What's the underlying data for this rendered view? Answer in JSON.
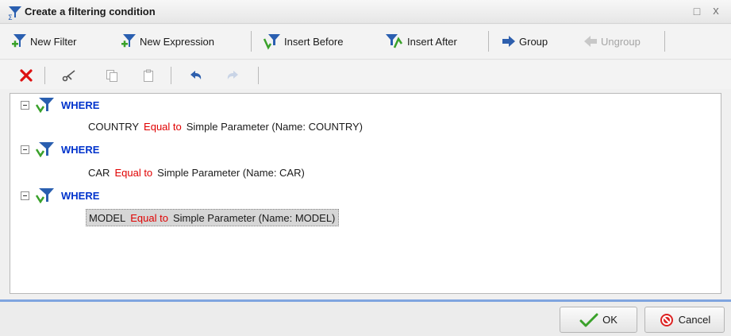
{
  "window": {
    "title": "Create a filtering condition",
    "maximize_glyph": "□",
    "close_glyph": "x"
  },
  "toolbar1": {
    "new_filter": "New Filter",
    "new_expression": "New Expression",
    "insert_before": "Insert Before",
    "insert_after": "Insert After",
    "group": "Group",
    "ungroup": "Ungroup"
  },
  "toolbar2": {
    "icons": [
      "delete-icon",
      "cut-icon",
      "copy-icon",
      "paste-icon",
      "undo-icon",
      "redo-icon"
    ]
  },
  "tree": {
    "groups": [
      {
        "keyword": "WHERE",
        "field": "COUNTRY",
        "operator": "Equal to",
        "value": "Simple Parameter (Name: COUNTRY)",
        "selected": false
      },
      {
        "keyword": "WHERE",
        "field": "CAR",
        "operator": "Equal to",
        "value": "Simple Parameter (Name: CAR)",
        "selected": false
      },
      {
        "keyword": "WHERE",
        "field": "MODEL",
        "operator": "Equal to",
        "value": "Simple Parameter (Name: MODEL)",
        "selected": true
      }
    ]
  },
  "footer": {
    "ok": "OK",
    "cancel": "Cancel"
  },
  "colors": {
    "keyword": "#0033cc",
    "operator": "#e00000",
    "accent_line": "#7fa5df",
    "filter_icon": "#2a5fb0",
    "check_green": "#3aa12a"
  }
}
